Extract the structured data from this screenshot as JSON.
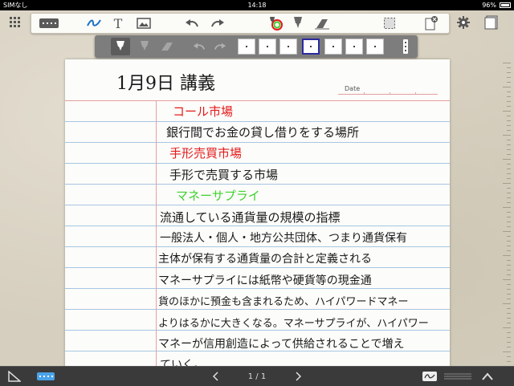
{
  "status_bar": {
    "carrier": "SIMなし",
    "time": "14:18",
    "battery": "96%"
  },
  "toolbar": {
    "text_tool_glyph": "T",
    "icons": [
      "grid-icon",
      "keyboard-icon",
      "pen-wave-icon",
      "text-icon",
      "image-icon",
      "undo-icon",
      "redo-icon",
      "color-pen-icon",
      "highlighter-icon",
      "eraser-icon",
      "select-icon",
      "delete-page-icon",
      "gear-icon"
    ]
  },
  "palette": {
    "pen_colors": [
      "#ffffff",
      "#ffffff",
      "#ffffff",
      "#ffffff",
      "#ffffff",
      "#ffffff",
      "#ffffff"
    ],
    "selected_index": 3,
    "selected_border": "#2b2ba0"
  },
  "page": {
    "title": "1月9日 講義",
    "date_label": "Date",
    "lines": [
      {
        "text": "コール市場",
        "color": "red"
      },
      {
        "text": "銀行間でお金の貸し借りをする場所",
        "color": "black"
      },
      {
        "text": "手形売買市場",
        "color": "red"
      },
      {
        "text": "手形で売買する市場",
        "color": "black"
      },
      {
        "text": "マネーサプライ",
        "color": "green"
      },
      {
        "text": "流通している通貨量の規模の指標",
        "color": "black"
      },
      {
        "text": "一般法人・個人・地方公共団体、つまり通貨保有",
        "color": "black"
      },
      {
        "text": "主体が保有する通貨量の合計と定義される",
        "color": "black"
      },
      {
        "text": "マネーサプライには紙幣や硬貨等の現金通",
        "color": "black"
      },
      {
        "text": "貨のほかに預金も含まれるため、ハイパワードマネー",
        "color": "black"
      },
      {
        "text": "よりはるかに大きくなる。マネーサプライが、ハイパワー",
        "color": "black"
      },
      {
        "text": "マネーが信用創造によって供給されることで増え",
        "color": "black"
      },
      {
        "text": "ていく。",
        "color": "black"
      }
    ]
  },
  "bottom_bar": {
    "page_indicator": "1 / 1"
  },
  "colors": {
    "accent_blue": "#1a73c9",
    "red_ink": "#e31a1a",
    "green_ink": "#3ed12d"
  }
}
